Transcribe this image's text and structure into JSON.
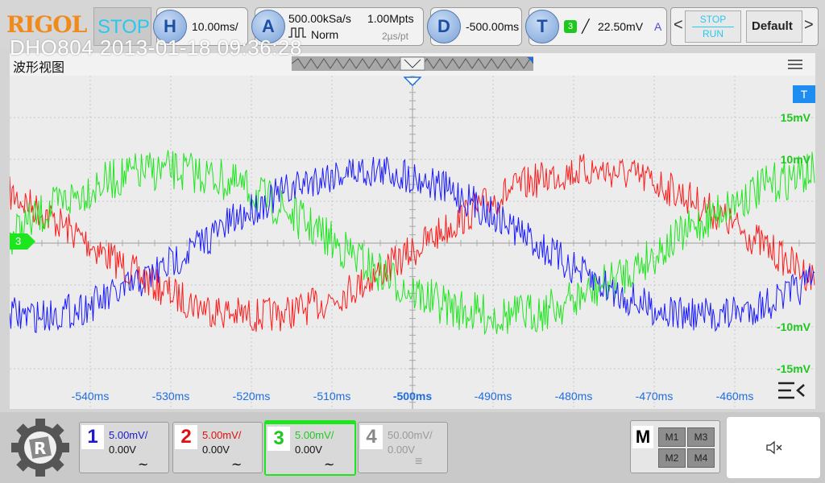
{
  "header": {
    "brand": "RIGOL",
    "stop_label": "STOP",
    "horizontal": {
      "key": "H",
      "value": "10.00ms/"
    },
    "acquire": {
      "key": "A",
      "rate": "500.00kSa/s",
      "depth": "1.00Mpts",
      "mode": "Norm",
      "pt": "2µs/pt"
    },
    "delay": {
      "key": "D",
      "value": "-500.00ms"
    },
    "trigger": {
      "key": "T",
      "channel": "3",
      "slope": "╱",
      "level": "22.50mV",
      "mode": "A"
    },
    "stop_run": {
      "stop": "STOP",
      "run": "RUN"
    },
    "default_label": "Default",
    "nav_prev": "<",
    "nav_next": ">"
  },
  "watermark": "DHO804 2013-01-18 09:36:28",
  "waveform_title": "波形视图",
  "scope": {
    "trigger_marker": "T",
    "channel_marker": "3",
    "right_scale": [
      "15mV",
      "10mV",
      "-10mV",
      "-15mV"
    ],
    "time_labels": [
      "-540ms",
      "-530ms",
      "-520ms",
      "-510ms",
      "-500ms",
      "-490ms",
      "-480ms",
      "-470ms",
      "-460ms"
    ],
    "colors": {
      "ch1": "#1a1aff",
      "ch2": "#ff1a1a",
      "ch3": "#1ee61e",
      "grid": "#c8c8c8"
    }
  },
  "channels": [
    {
      "num": "1",
      "scale": "5.00mV/",
      "offset": "0.00V",
      "coupling": "∼",
      "color": "#1a1acc"
    },
    {
      "num": "2",
      "scale": "5.00mV/",
      "offset": "0.00V",
      "coupling": "∼",
      "color": "#e01010"
    },
    {
      "num": "3",
      "scale": "5.00mV/",
      "offset": "0.00V",
      "coupling": "∼",
      "color": "#1ec81e"
    },
    {
      "num": "4",
      "scale": "50.00mV/",
      "offset": "0.00V",
      "coupling": "≡",
      "color": "#888888"
    }
  ],
  "math": {
    "label": "M",
    "items": [
      "M1",
      "M3",
      "M2",
      "M4"
    ]
  },
  "sound_icon": "speaker-muted-icon"
}
